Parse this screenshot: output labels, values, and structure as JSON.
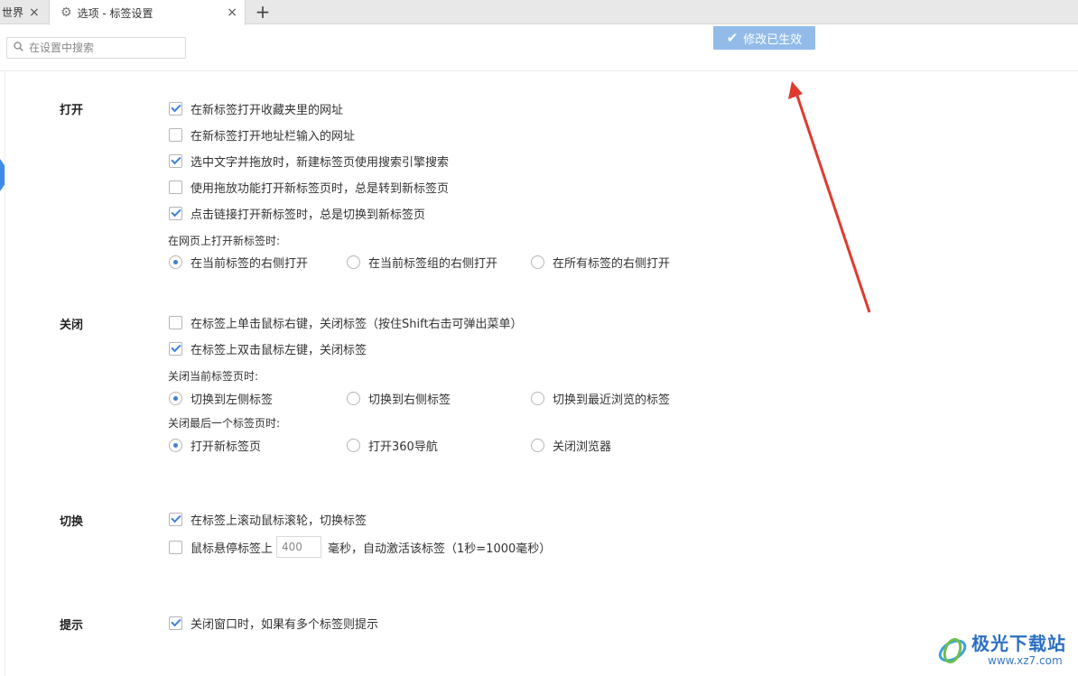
{
  "tabs": [
    {
      "label": "世界",
      "close": "×"
    },
    {
      "label": "选项 - 标签设置",
      "close": "×"
    }
  ],
  "new_tab": "+",
  "search": {
    "placeholder": "在设置中搜索"
  },
  "toast": {
    "text": "修改已生效"
  },
  "sections": {
    "open": {
      "title": "打开",
      "options": [
        {
          "label": "在新标签打开收藏夹里的网址",
          "checked": true
        },
        {
          "label": "在新标签打开地址栏输入的网址",
          "checked": false
        },
        {
          "label": "选中文字并拖放时，新建标签页使用搜索引擎搜索",
          "checked": true
        },
        {
          "label": "使用拖放功能打开新标签页时，总是转到新标签页",
          "checked": false
        },
        {
          "label": "点击链接打开新标签时，总是切换到新标签页",
          "checked": true
        }
      ],
      "sub_label": "在网页上打开新标签时:",
      "radios": [
        "在当前标签的右侧打开",
        "在当前标签组的右侧打开",
        "在所有标签的右侧打开"
      ],
      "selected": 0
    },
    "close": {
      "title": "关闭",
      "options": [
        {
          "label": "在标签上单击鼠标右键，关闭标签（按住Shift右击可弹出菜单）",
          "checked": false
        },
        {
          "label": "在标签上双击鼠标左键，关闭标签",
          "checked": true
        }
      ],
      "sub_label_1": "关闭当前标签页时:",
      "radios_1": [
        "切换到左侧标签",
        "切换到右侧标签",
        "切换到最近浏览的标签"
      ],
      "selected_1": 0,
      "sub_label_2": "关闭最后一个标签页时:",
      "radios_2": [
        "打开新标签页",
        "打开360导航",
        "关闭浏览器"
      ],
      "selected_2": 0
    },
    "switch": {
      "title": "切换",
      "option_1": {
        "label": "在标签上滚动鼠标滚轮，切换标签",
        "checked": true
      },
      "option_2": {
        "label_before": "鼠标悬停标签上",
        "value": "400",
        "label_after": "毫秒，自动激活该标签（1秒=1000毫秒）",
        "checked": false
      }
    },
    "tips": {
      "title": "提示",
      "option_1": {
        "label": "关闭窗口时，如果有多个标签则提示",
        "checked": true
      }
    }
  },
  "watermark": {
    "title": "极光下载站",
    "url": "www.xz7.com"
  },
  "colors": {
    "accent": "#3d7fd6",
    "toast_bg": "#92bbea",
    "arrow": "#e03a2f"
  }
}
